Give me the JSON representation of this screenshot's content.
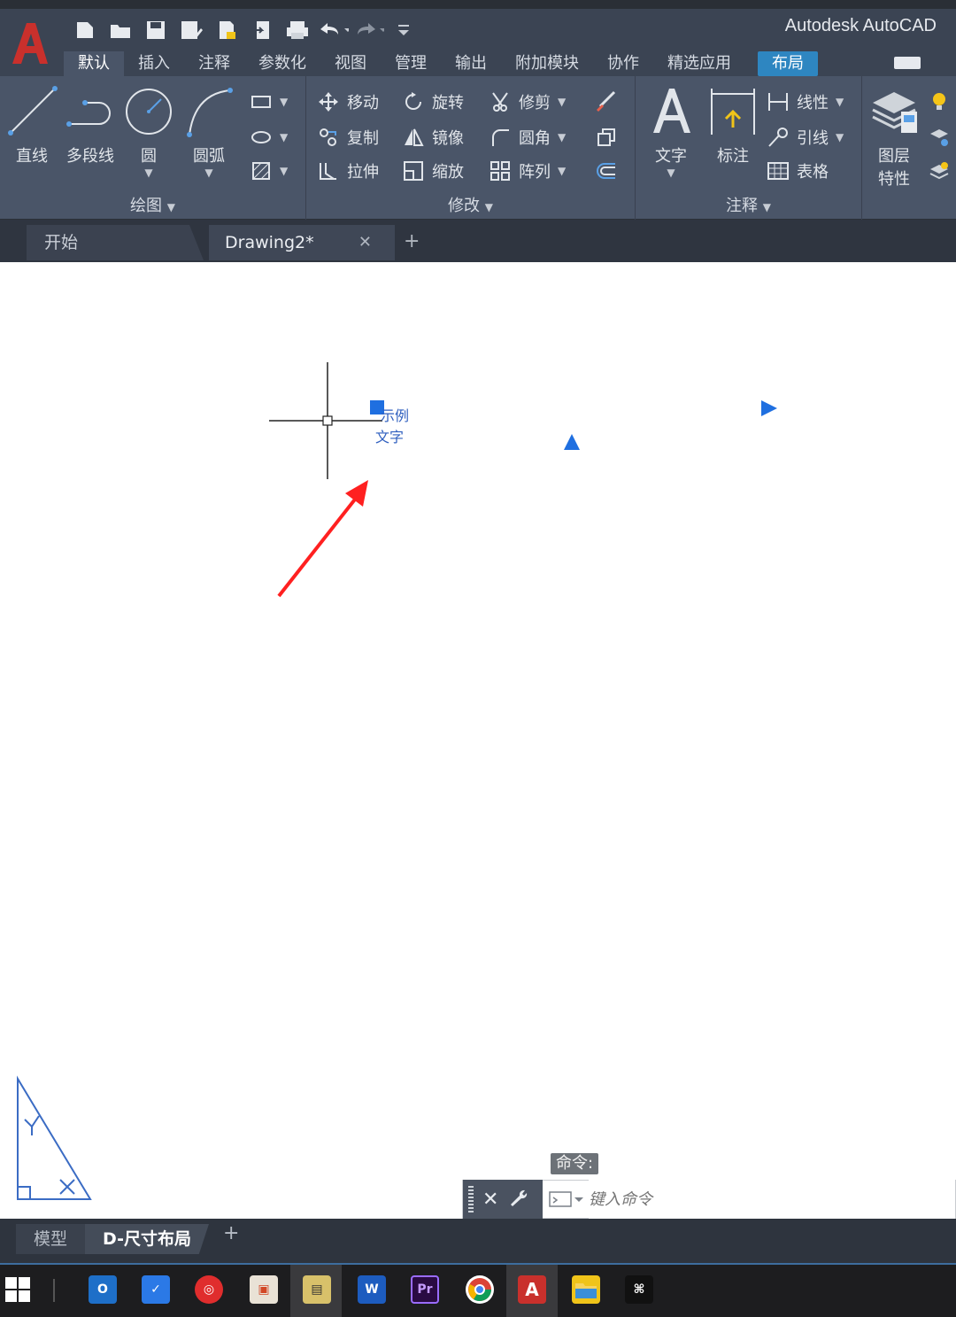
{
  "app": {
    "title": "Autodesk AutoCAD",
    "logo_letter": "A"
  },
  "quick_access": [
    "new-icon",
    "open-icon",
    "save-icon",
    "save-as-icon",
    "plot-preview-icon",
    "publish-icon",
    "print-icon",
    "undo-icon",
    "redo-icon",
    "customize-icon"
  ],
  "ribbon_tabs": [
    {
      "label": "默认",
      "active": true
    },
    {
      "label": "插入"
    },
    {
      "label": "注释"
    },
    {
      "label": "参数化"
    },
    {
      "label": "视图"
    },
    {
      "label": "管理"
    },
    {
      "label": "输出"
    },
    {
      "label": "附加模块"
    },
    {
      "label": "协作"
    },
    {
      "label": "精选应用"
    },
    {
      "label": "布局",
      "highlight": true
    }
  ],
  "panels": {
    "draw": {
      "title": "绘图",
      "tools": {
        "line": "直线",
        "polyline": "多段线",
        "circle": "圆",
        "arc": "圆弧"
      }
    },
    "modify": {
      "title": "修改",
      "tools": {
        "move": "移动",
        "rotate": "旋转",
        "trim": "修剪",
        "copy": "复制",
        "mirror": "镜像",
        "fillet": "圆角",
        "stretch": "拉伸",
        "scale": "缩放",
        "array": "阵列"
      }
    },
    "annotation": {
      "title": "注释",
      "tools": {
        "text": "文字",
        "dimension": "标注",
        "linear": "线性",
        "leader": "引线",
        "table": "表格"
      }
    },
    "layers": {
      "tools": {
        "layer_properties_line1": "图层",
        "layer_properties_line2": "特性"
      }
    }
  },
  "file_tabs": {
    "start": "开始",
    "drawing": "Drawing2*",
    "close": "✕",
    "add": "+"
  },
  "canvas": {
    "sample_text_line1": "示例",
    "sample_text_line2": "文字",
    "arrow_color": "#ff2020",
    "grip_color": "#1f6fe0"
  },
  "command": {
    "label": "命令:",
    "placeholder": "键入命令"
  },
  "layout_tabs": {
    "model": "模型",
    "layout": "D-尺寸布局",
    "add": "+"
  },
  "taskbar": {
    "icons": [
      "windows-start-icon",
      "outlook-icon",
      "feishu-icon",
      "netease-music-icon",
      "office-icon",
      "video-editor-icon",
      "word-icon",
      "premiere-icon",
      "chrome-icon",
      "autocad-icon",
      "file-explorer-icon",
      "capcut-icon"
    ]
  }
}
